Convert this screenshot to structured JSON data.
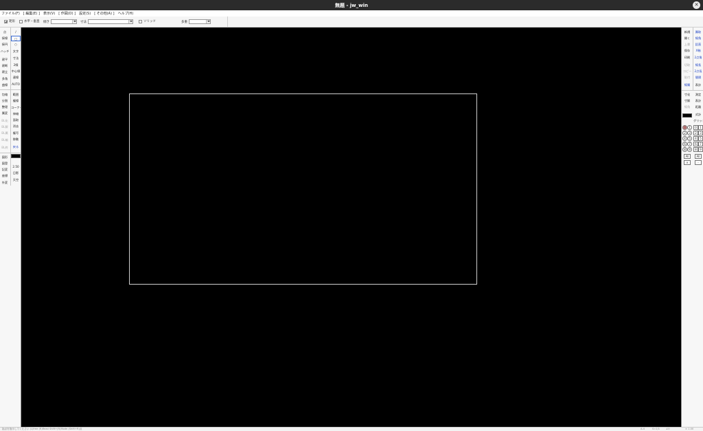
{
  "window": {
    "title": "無題 - jw_win"
  },
  "menu": [
    "ファイル(F)",
    "[ 編集(E) ]",
    "表示(V)",
    "[ 作図(D) ]",
    "設定(S)",
    "[ その他(A) ]",
    "ヘルプ(H)"
  ],
  "toolbar": {
    "rect_label": "矩形",
    "horiz_label": "水平・垂直",
    "slope_label": "傾き",
    "dim_label": "寸法",
    "solid_label": "ソリッド",
    "multi_label": "多重"
  },
  "left_tools": {
    "col1": [
      "点",
      "接線",
      "接円",
      "ハッチ",
      "建平",
      "建断",
      "建立",
      "多角",
      "曲線",
      "包絡",
      "分割",
      "整理",
      "属変",
      "BL化",
      "BL解",
      "BL属",
      "BL編",
      "BL終",
      "図形",
      "図登",
      "記変",
      "座標",
      "外変"
    ],
    "col2": [
      "/",
      "□",
      "○",
      "文字",
      "寸法",
      "2線",
      "中心線",
      "連線",
      "AUTO",
      "範囲",
      "複線",
      "コーナー",
      "伸縮",
      "面取",
      "消去",
      "複写",
      "移動",
      "戻る",
      "2.50",
      "日影",
      "天空"
    ]
  },
  "right_tools": {
    "col1": [
      "新規",
      "開く",
      "上書",
      "保存",
      "印刷",
      "切取",
      "コピー",
      "貼付",
      "線属",
      "寸化",
      "寸解",
      "線角",
      "鉛直"
    ],
    "col2": [
      "属取",
      "線角",
      "鉛直",
      "X軸",
      "2点角",
      "線長",
      "2点長",
      "間隔",
      "表計",
      "測定",
      "表計",
      "距離",
      "式計",
      "グリッド"
    ]
  },
  "numpad": {
    "left": [
      "0",
      "1",
      "2",
      "3",
      "4",
      "5",
      "6",
      "7",
      "8",
      "9"
    ],
    "right": [
      "0",
      "1",
      "2",
      "3",
      "4",
      "5",
      "6",
      "7",
      "8",
      "9"
    ],
    "bottom_left": [
      "All",
      "×"
    ],
    "bottom_right": [
      "All",
      "-"
    ]
  },
  "status": {
    "message": "始点を指示してください (L)free (R)Read  Shift+(R)Mode   (Shift+R)点",
    "paper": "A-4",
    "scale": "S=1/1",
    "angle": "∠0",
    "zoom": "× 1.00"
  },
  "colors": {
    "canvas": "#000000",
    "frame": "#cfcfcf",
    "accent": "#1a3fc4"
  }
}
